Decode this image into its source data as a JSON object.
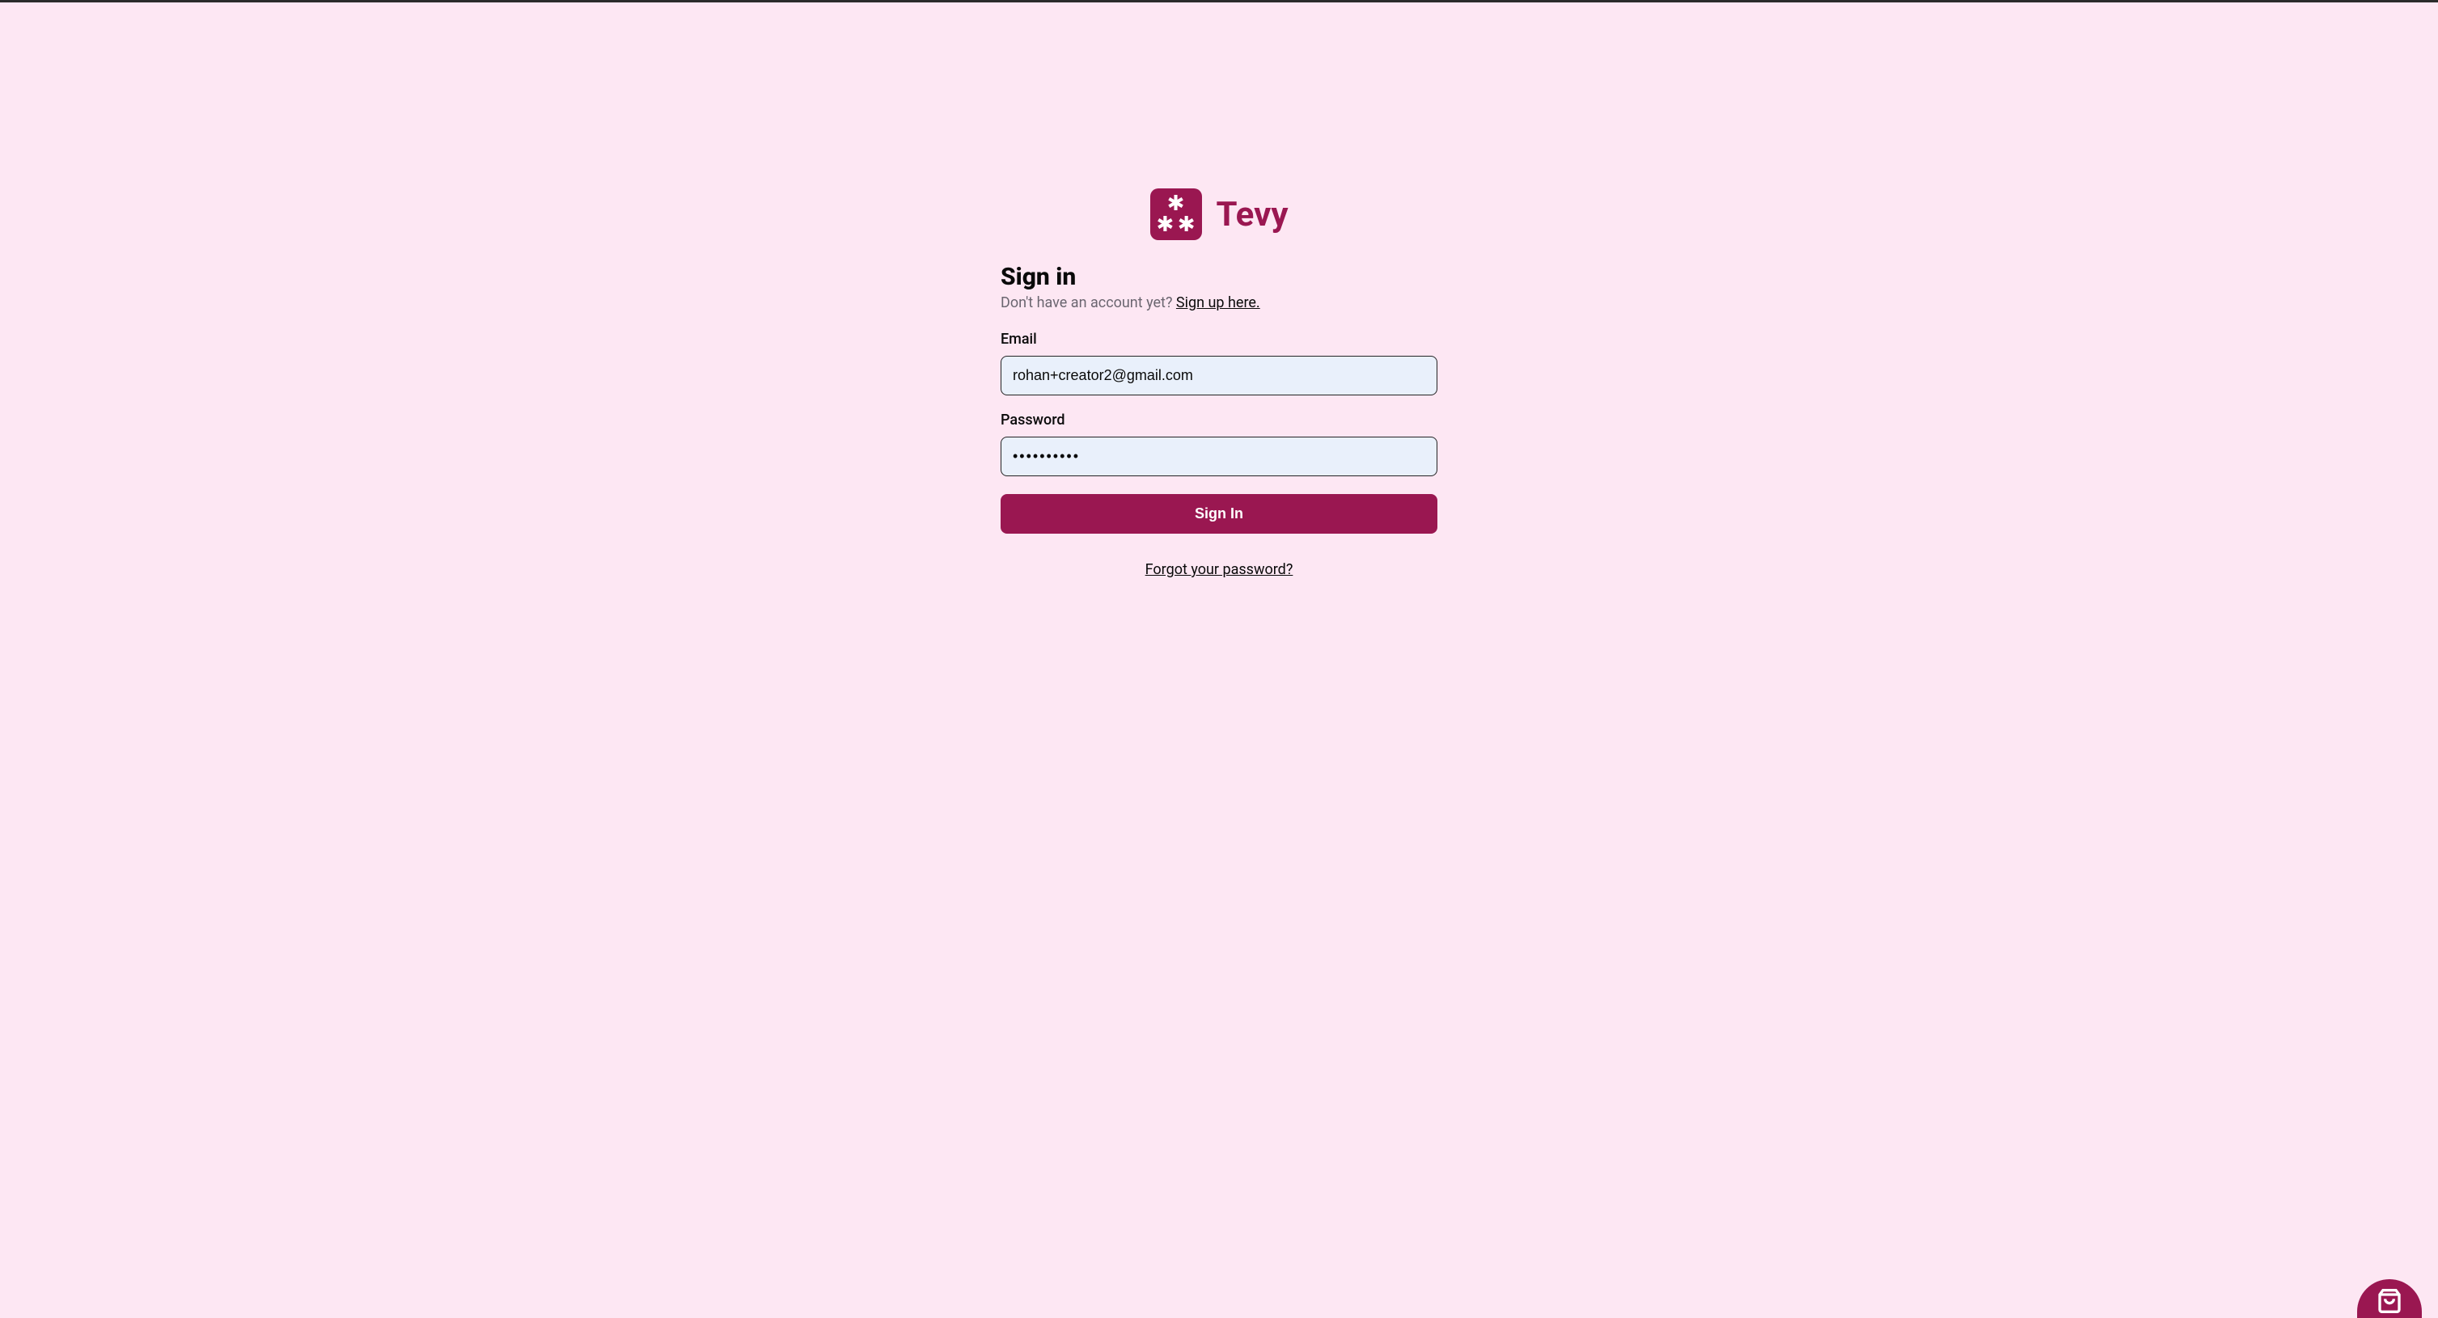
{
  "brand": {
    "name": "Tevy"
  },
  "form": {
    "heading": "Sign in",
    "no_account_text": "Don't have an account yet? ",
    "signup_link": "Sign up here.",
    "email_label": "Email",
    "email_value": "rohan+creator2@gmail.com",
    "password_label": "Password",
    "password_value": "••••••••••",
    "submit_label": "Sign In",
    "forgot_link": "Forgot your password?"
  }
}
